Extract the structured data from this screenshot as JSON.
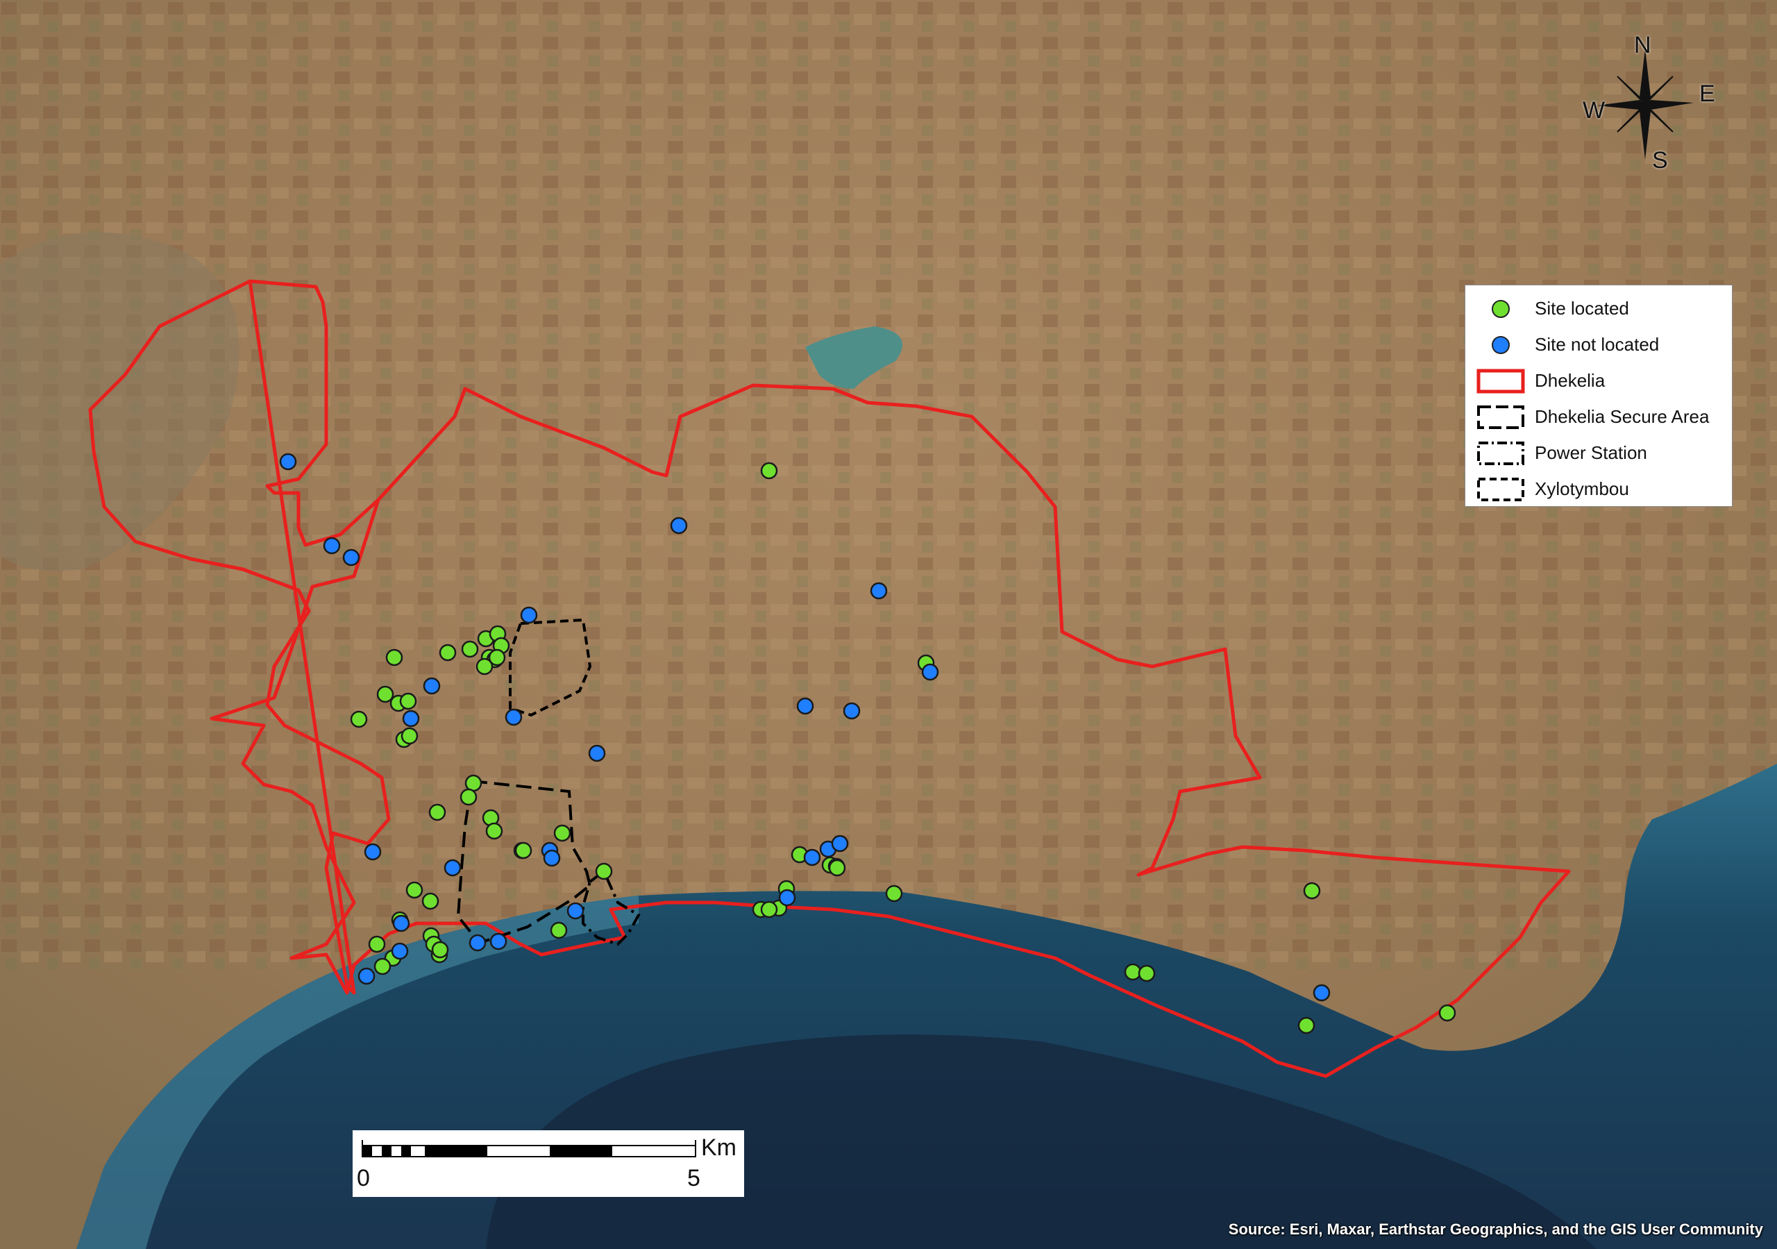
{
  "legend": {
    "items": [
      {
        "label": "Site located",
        "kind": "dot",
        "color": "#6fe030"
      },
      {
        "label": "Site not located",
        "kind": "dot",
        "color": "#1f7fff"
      },
      {
        "label": "Dhekelia",
        "kind": "box-red",
        "color": "#e8201e"
      },
      {
        "label": "Dhekelia Secure Area",
        "kind": "box-dash",
        "color": "#000000"
      },
      {
        "label": "Power Station",
        "kind": "box-dashdot",
        "color": "#000000"
      },
      {
        "label": "Xylotymbou",
        "kind": "box-shortdash",
        "color": "#000000"
      }
    ]
  },
  "scale": {
    "unit": "Km",
    "start": "0",
    "end": "5"
  },
  "compass": {
    "n": "N",
    "e": "E",
    "s": "S",
    "w": "W",
    "icon": "compass-rose-icon"
  },
  "source": "Source: Esri, Maxar, Earthstar Geographics, and the GIS User Community",
  "colors": {
    "boundary": "#e8201e",
    "located": "#6fe030",
    "not_located": "#1f7fff",
    "sea": "#1f4a66",
    "land": "#9b7a55"
  }
}
